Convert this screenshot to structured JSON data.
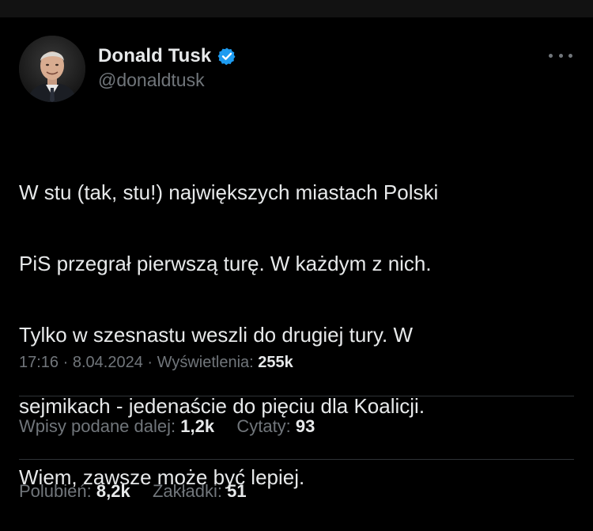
{
  "author": {
    "display_name": "Donald Tusk",
    "handle": "@donaldtusk",
    "avatar_icon": "profile-photo",
    "verified_icon": "verified-badge-icon",
    "verified_color": "#1d9bf0"
  },
  "tweet": {
    "text_lines": [
      "W stu (tak, stu!) największych miastach Polski",
      "PiS przegrał pierwszą turę. W każdym z nich.",
      "Tylko w szesnastu weszli do drugiej tury. W",
      "sejmikach - jedenaście do pięciu dla Koalicji.",
      "Wiem, zawsze może być lepiej."
    ],
    "time": "17:16",
    "separator": "·",
    "date": "8.04.2024",
    "views_label": "Wyświetlenia:",
    "views_value": "255k"
  },
  "engagement": {
    "reposts_label": "Wpisy podane dalej:",
    "reposts_value": "1,2k",
    "quotes_label": "Cytaty:",
    "quotes_value": "93",
    "likes_label": "Polubień:",
    "likes_value": "8,2k",
    "bookmarks_label": "Zakładki:",
    "bookmarks_value": "51"
  },
  "colors": {
    "background": "#000000",
    "text": "#e7e9ea",
    "secondary": "#71767b",
    "divider": "#2f3336"
  },
  "more_icon": "more-horizontal-icon"
}
